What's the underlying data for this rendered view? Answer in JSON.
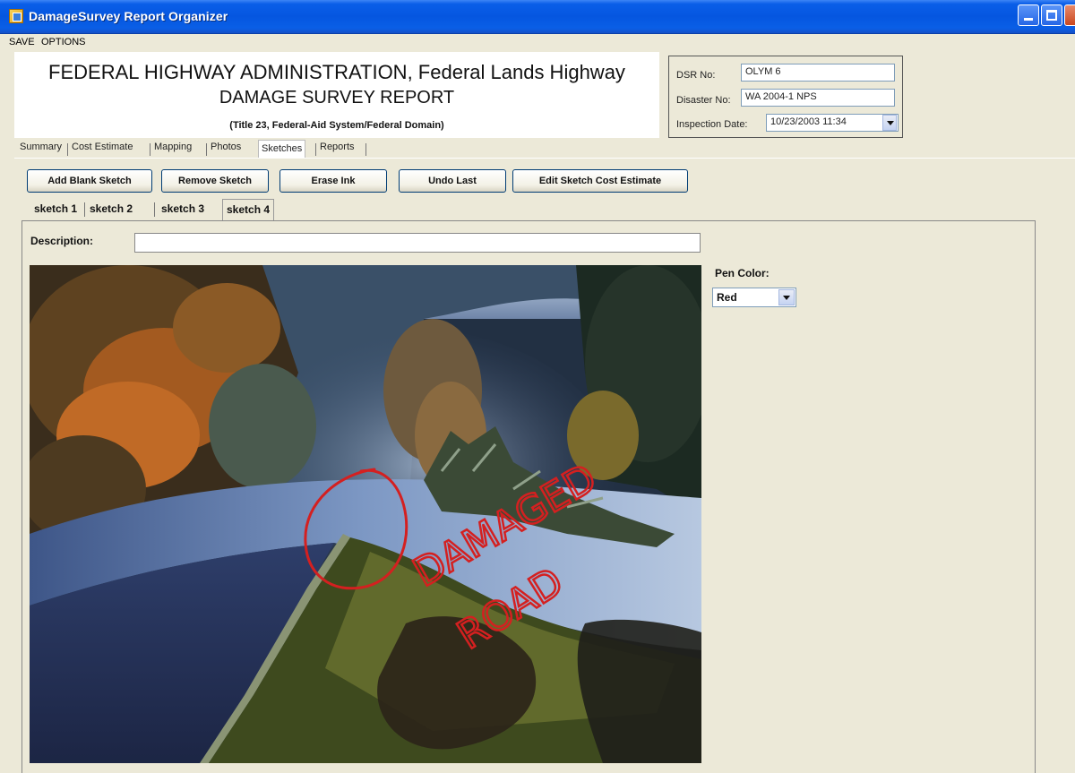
{
  "window": {
    "title": "DamageSurvey Report Organizer"
  },
  "menu": {
    "save": "SAVE",
    "options": "OPTIONS"
  },
  "header": {
    "line1": "FEDERAL HIGHWAY ADMINISTRATION, Federal Lands Highway",
    "line2": "DAMAGE SURVEY REPORT",
    "line3": "(Title 23, Federal-Aid System/Federal Domain)"
  },
  "dsr": {
    "dsr_no_label": "DSR No:",
    "dsr_no_value": "OLYM 6",
    "disaster_no_label": "Disaster No:",
    "disaster_no_value": "WA 2004-1 NPS",
    "inspection_date_label": "Inspection Date:",
    "inspection_date_value": "10/23/2003 11:34"
  },
  "tabs": [
    "Summary",
    "Cost Estimate",
    "Mapping",
    "Photos",
    "Sketches",
    "Reports"
  ],
  "active_tab": "Sketches",
  "toolbar": {
    "add_blank": "Add Blank Sketch",
    "remove": "Remove Sketch",
    "erase": "Erase Ink",
    "undo": "Undo Last",
    "edit_cost": "Edit Sketch Cost Estimate"
  },
  "sketch_tabs": [
    "sketch 1",
    "sketch 2",
    "sketch 3",
    "sketch 4"
  ],
  "active_sketch": "sketch 4",
  "description": {
    "label": "Description:",
    "value": ""
  },
  "pen": {
    "label": "Pen Color:",
    "value": "Red"
  },
  "sketch": {
    "ink_word1": "DAMAGED",
    "ink_word2": "ROAD",
    "ink_color": "#d42020"
  }
}
